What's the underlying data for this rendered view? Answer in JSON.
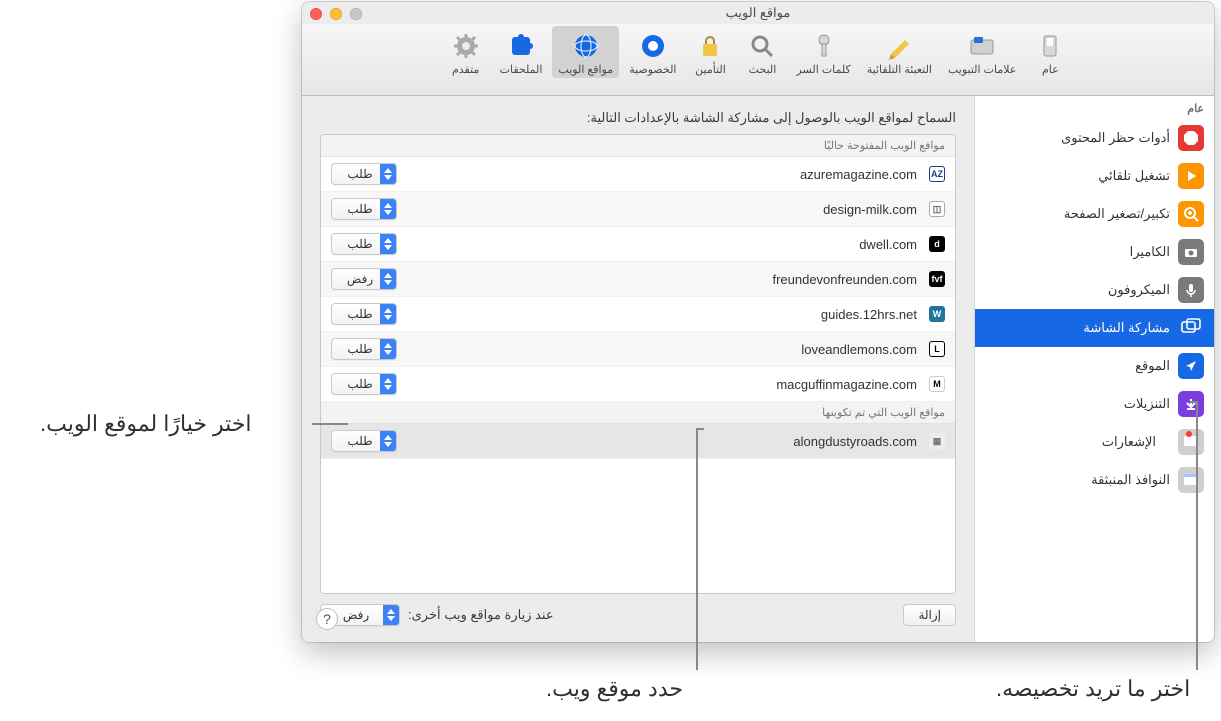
{
  "window": {
    "title": "مواقع الويب"
  },
  "toolbar": [
    {
      "id": "general",
      "label": "عام"
    },
    {
      "id": "tabs",
      "label": "علامات التبويب"
    },
    {
      "id": "autofill",
      "label": "التعبئة التلقائية"
    },
    {
      "id": "passwords",
      "label": "كلمات السر"
    },
    {
      "id": "search",
      "label": "البحث"
    },
    {
      "id": "security",
      "label": "التأمين"
    },
    {
      "id": "privacy",
      "label": "الخصوصية"
    },
    {
      "id": "websites",
      "label": "مواقع الويب",
      "selected": true
    },
    {
      "id": "extensions",
      "label": "الملحقات"
    },
    {
      "id": "advanced",
      "label": "متقدم"
    }
  ],
  "sidebar": {
    "header": "عام",
    "items": [
      {
        "id": "content-blockers",
        "label": "أدوات حظر المحتوى"
      },
      {
        "id": "autoplay",
        "label": "تشغيل تلقائي"
      },
      {
        "id": "page-zoom",
        "label": "تكبير/تصغير الصفحة"
      },
      {
        "id": "camera",
        "label": "الكاميرا"
      },
      {
        "id": "microphone",
        "label": "الميكروفون"
      },
      {
        "id": "screen-sharing",
        "label": "مشاركة الشاشة",
        "selected": true
      },
      {
        "id": "location",
        "label": "الموقع"
      },
      {
        "id": "downloads",
        "label": "التنزيلات"
      },
      {
        "id": "notifications",
        "label": "الإشعارات",
        "badge": true
      },
      {
        "id": "popups",
        "label": "النوافذ المنبثقة"
      }
    ]
  },
  "content": {
    "section_label": "السماح لمواقع الويب بالوصول إلى مشاركة الشاشة بالإعدادات التالية:",
    "group_open": "مواقع الويب المفتوحة حاليًا",
    "group_configured": "مواقع الويب التي تم تكوينها",
    "rows_open": [
      {
        "domain": "azuremagazine.com",
        "icon": "AZ",
        "bg": "#fff",
        "fg": "#1e3a8a",
        "border": "#1e3a8a",
        "option": "طلب"
      },
      {
        "domain": "design-milk.com",
        "icon": "◫",
        "bg": "#fff",
        "fg": "#555",
        "border": "#aaa",
        "option": "طلب"
      },
      {
        "domain": "dwell.com",
        "icon": "d",
        "bg": "#000",
        "fg": "#fff",
        "option": "طلب"
      },
      {
        "domain": "freundevonfreunden.com",
        "icon": "fvf",
        "bg": "#000",
        "fg": "#fff",
        "option": "رفض"
      },
      {
        "domain": "guides.12hrs.net",
        "icon": "W",
        "bg": "#21759b",
        "fg": "#fff",
        "option": "طلب"
      },
      {
        "domain": "loveandlemons.com",
        "icon": "L",
        "bg": "#fff",
        "fg": "#000",
        "border": "#000",
        "option": "طلب"
      },
      {
        "domain": "macguffinmagazine.com",
        "icon": "M",
        "bg": "#fff",
        "fg": "#000",
        "border": "#ccc",
        "option": "طلب"
      }
    ],
    "rows_configured": [
      {
        "domain": "alongdustyroads.com",
        "icon": "▦",
        "bg": "#eee",
        "fg": "#777",
        "option": "طلب",
        "sel": true
      }
    ]
  },
  "footer": {
    "remove": "إزالة",
    "other_label": "عند زيارة مواقع ويب أخرى:",
    "other_value": "رفض"
  },
  "callouts": {
    "sidebar": "اختر ما تريد تخصيصه.",
    "row": "حدد موقع ويب.",
    "popup": "اختر خيارًا لموقع الويب."
  }
}
